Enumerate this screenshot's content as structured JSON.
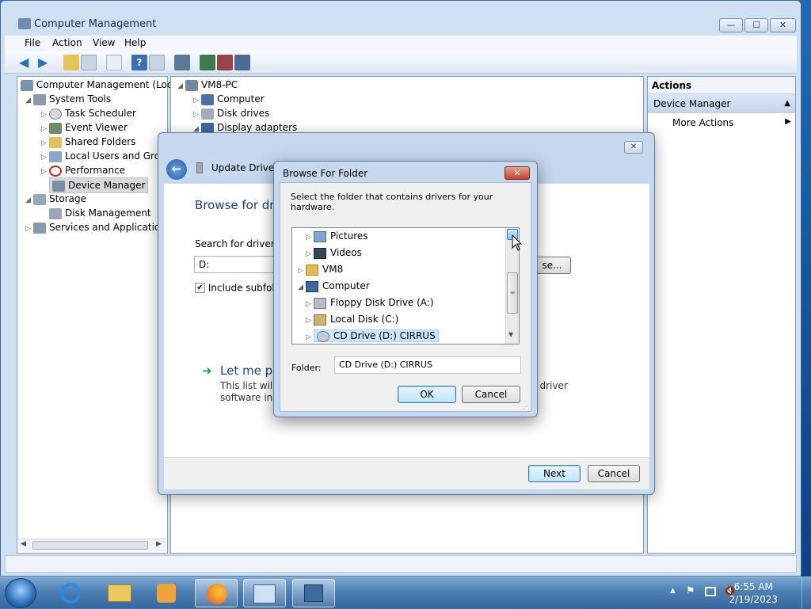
{
  "window": {
    "title": "Computer Management",
    "menu": [
      "File",
      "Action",
      "View",
      "Help"
    ],
    "min_glyph": "—",
    "max_glyph": "☐",
    "close_glyph": "✕"
  },
  "tree": [
    {
      "label": "Computer Management (Local",
      "icon": "computer-management-icon",
      "level": 0,
      "arrow": ""
    },
    {
      "label": "System Tools",
      "icon": "tools-icon",
      "level": 1,
      "arrow": "◢"
    },
    {
      "label": "Task Scheduler",
      "icon": "clock-icon",
      "level": 2,
      "arrow": "▷"
    },
    {
      "label": "Event Viewer",
      "icon": "event-viewer-icon",
      "level": 2,
      "arrow": "▷"
    },
    {
      "label": "Shared Folders",
      "icon": "shared-folder-icon",
      "level": 2,
      "arrow": "▷"
    },
    {
      "label": "Local Users and Group",
      "icon": "users-icon",
      "level": 2,
      "arrow": "▷"
    },
    {
      "label": "Performance",
      "icon": "performance-icon",
      "level": 2,
      "arrow": "▷"
    },
    {
      "label": "Device Manager",
      "icon": "device-manager-icon",
      "level": 2,
      "arrow": "",
      "selected": true
    },
    {
      "label": "Storage",
      "icon": "storage-icon",
      "level": 1,
      "arrow": "◢"
    },
    {
      "label": "Disk Management",
      "icon": "disk-icon",
      "level": 2,
      "arrow": ""
    },
    {
      "label": "Services and Applications",
      "icon": "services-icon",
      "level": 1,
      "arrow": "▷"
    }
  ],
  "devices": [
    {
      "label": "VM8-PC",
      "arrow": "◢"
    },
    {
      "label": "Computer",
      "arrow": "▷"
    },
    {
      "label": "Disk drives",
      "arrow": "▷"
    },
    {
      "label": "Display adapters",
      "arrow": "◢"
    }
  ],
  "actions": {
    "header": "Actions",
    "section": "Device Manager",
    "more": "More Actions"
  },
  "update": {
    "title": "Update Driver S",
    "heading": "Browse for driv",
    "search_label": "Search for driver so",
    "path_value": "D:",
    "include_label": "Include subfolde",
    "browse_label": "se...",
    "letme": "Let me pic",
    "desc1": "This list will s",
    "desc1b": "ll driver",
    "desc2": "software in t",
    "next": "Next",
    "cancel": "Cancel"
  },
  "browse": {
    "title": "Browse For Folder",
    "instruction": "Select the folder that contains drivers for your hardware.",
    "items": [
      {
        "label": "Pictures",
        "icon": "pictures-folder-icon",
        "indent": 1,
        "arrow": "▷"
      },
      {
        "label": "Videos",
        "icon": "videos-folder-icon",
        "indent": 1,
        "arrow": "▷"
      },
      {
        "label": "VM8",
        "icon": "user-folder-icon",
        "indent": 0,
        "arrow": "▷"
      },
      {
        "label": "Computer",
        "icon": "computer-icon",
        "indent": 0,
        "arrow": "◢"
      },
      {
        "label": "Floppy Disk Drive (A:)",
        "icon": "floppy-icon",
        "indent": 1,
        "arrow": "▷"
      },
      {
        "label": "Local Disk (C:)",
        "icon": "local-disk-icon",
        "indent": 1,
        "arrow": "▷"
      },
      {
        "label": "CD Drive (D:) CIRRUS",
        "icon": "cd-drive-icon",
        "indent": 1,
        "arrow": "▷",
        "selected": true
      }
    ],
    "folder_label": "Folder:",
    "folder_value": "CD Drive (D:) CIRRUS",
    "ok": "OK",
    "cancel": "Cancel"
  },
  "taskbar": {
    "time": "6:55 AM",
    "date": "2/19/2023",
    "apps": [
      "internet-explorer-icon",
      "explorer-icon",
      "media-player-icon",
      "firefox-icon",
      "computer-management-icon",
      "device-manager-icon"
    ]
  }
}
